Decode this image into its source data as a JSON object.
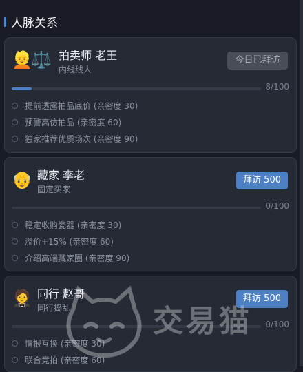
{
  "header": {
    "title": "人脉关系"
  },
  "contacts": [
    {
      "avatar": "👱",
      "avatar2": "⚖️",
      "name": "拍卖师 老王",
      "role": "内线线人",
      "visit_label": "今日已拜访",
      "visited": true,
      "progress": 8,
      "progress_max": 100,
      "progress_text": "8/100",
      "perks": [
        "提前透露拍品底价 (亲密度 30)",
        "预警高仿拍品 (亲密度 60)",
        "独家推荐优质场次 (亲密度 90)"
      ]
    },
    {
      "avatar": "👴",
      "name": "藏家 李老",
      "role": "固定买家",
      "visit_label": "拜访 500",
      "visited": false,
      "progress": 0,
      "progress_max": 100,
      "progress_text": "0/100",
      "perks": [
        "稳定收购瓷器 (亲密度 30)",
        "溢价+15% (亲密度 60)",
        "介绍高端藏家圈 (亲密度 90)"
      ]
    },
    {
      "avatar": "🤵",
      "name": "同行 赵哥",
      "role": "同行捣乱",
      "visit_label": "拜访 500",
      "visited": false,
      "progress": 0,
      "progress_max": 100,
      "progress_text": "0/100",
      "perks": [
        "情报互换 (亲密度 30)",
        "联合竞拍 (亲密度 60)"
      ]
    }
  ],
  "watermark": {
    "text": "交易猫"
  },
  "colors": {
    "accent": "#4a86d8",
    "button": "#4c7fc3",
    "card": "#262a35",
    "background": "#191c24"
  }
}
